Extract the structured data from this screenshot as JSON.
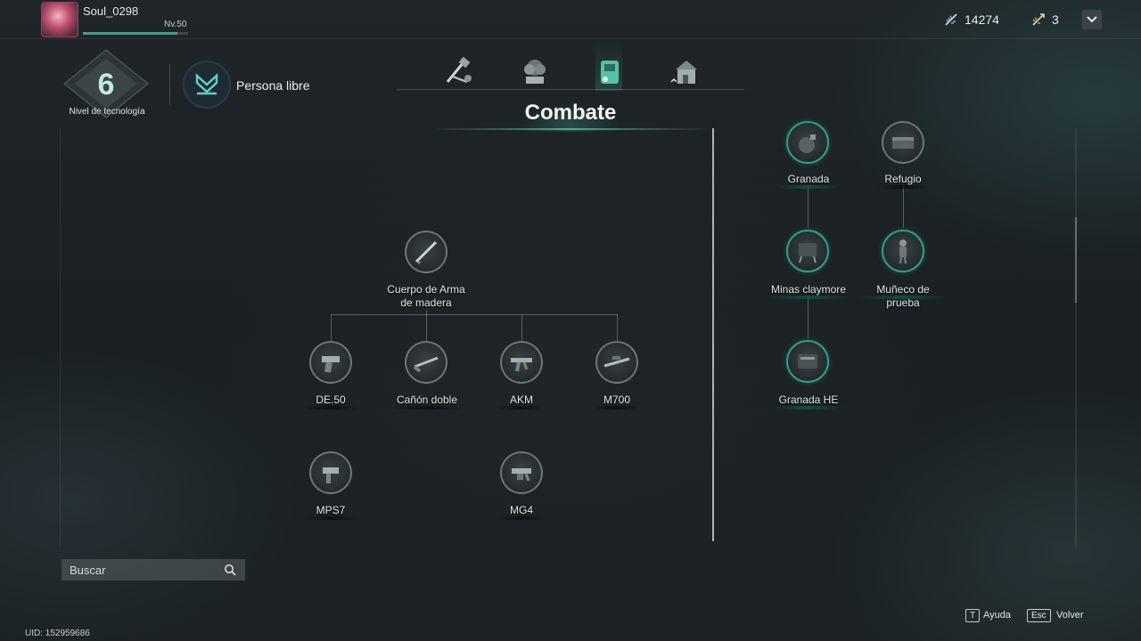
{
  "player": {
    "name": "Soul_0298",
    "level": "Nv.50",
    "xp_progress": 0.9
  },
  "currencies": [
    {
      "icon": "feather-currency-icon",
      "value": "14274"
    },
    {
      "icon": "arrow-token-icon",
      "value": "3"
    }
  ],
  "tech": {
    "level": "6",
    "label": "Nivel de tecnología"
  },
  "persona": {
    "label": "Persona libre"
  },
  "categories": {
    "tabs": [
      {
        "icon": "tools-icon",
        "active": false
      },
      {
        "icon": "plant-icon",
        "active": false
      },
      {
        "icon": "combat-gear-icon",
        "active": true
      },
      {
        "icon": "building-icon",
        "active": false
      }
    ],
    "active_title": "Combate"
  },
  "weapon_tree": {
    "root": {
      "label": "Cuerpo de Arma\nde madera",
      "icon": "rifle-icon"
    },
    "tier1": [
      {
        "label": "DE.50",
        "icon": "pistol-icon"
      },
      {
        "label": "Cañón doble",
        "icon": "shotgun-icon"
      },
      {
        "label": "AKM",
        "icon": "assault-rifle-icon"
      },
      {
        "label": "M700",
        "icon": "sniper-rifle-icon"
      }
    ],
    "tier2": [
      {
        "label": "MPS7",
        "icon": "smg-icon"
      },
      {
        "label": "MG4",
        "icon": "machine-gun-icon"
      }
    ]
  },
  "gear_tree": {
    "items": [
      {
        "label": "Granada",
        "icon": "grenade-icon",
        "unlocked": true
      },
      {
        "label": "Refugio",
        "icon": "shelter-icon",
        "unlocked": false
      },
      {
        "label": "Minas claymore",
        "icon": "claymore-icon",
        "unlocked": true
      },
      {
        "label": "Muñeco de\nprueba",
        "icon": "dummy-icon",
        "unlocked": true
      },
      {
        "label": "Granada HE",
        "icon": "he-grenade-icon",
        "unlocked": true
      }
    ]
  },
  "search": {
    "placeholder": "Buscar"
  },
  "footer": {
    "uid": "UID: 152959686",
    "help_key": "T",
    "help_label": "Ayuda",
    "back_key": "Esc",
    "back_label": "Volver"
  },
  "colors": {
    "accent": "#2f9e86",
    "background": "#1b2124"
  }
}
